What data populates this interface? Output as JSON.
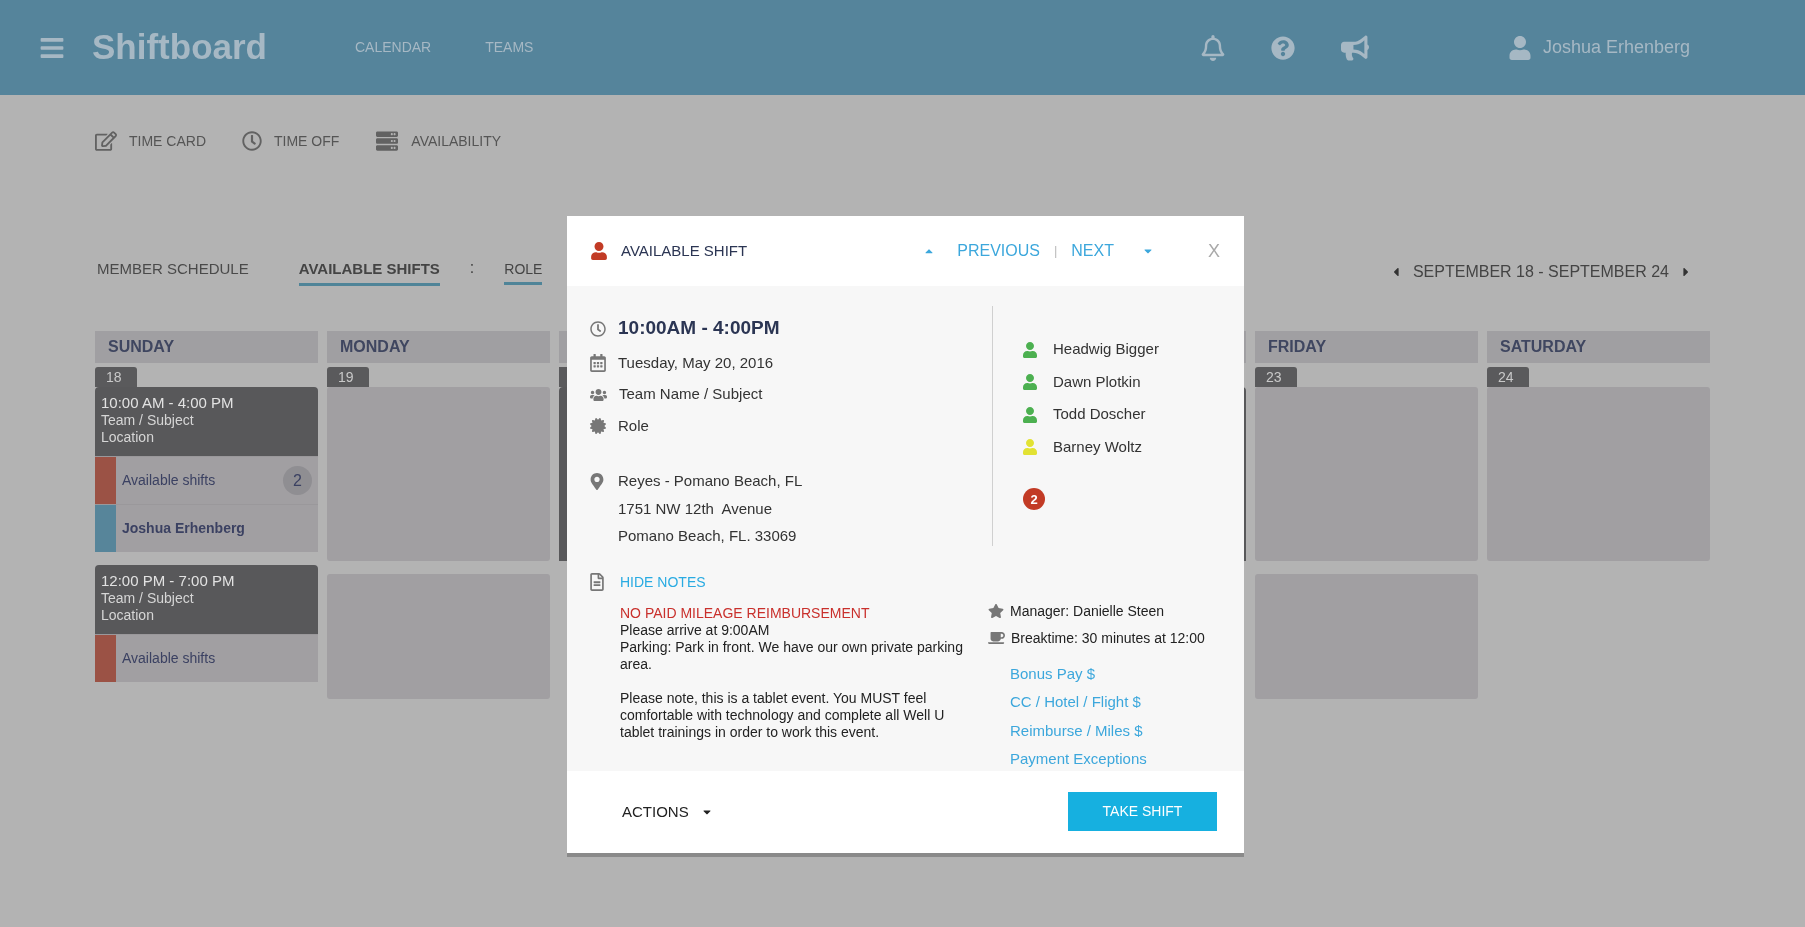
{
  "header": {
    "logo": "Shiftboard",
    "nav": [
      "CALENDAR",
      "TEAMS"
    ],
    "user": "Joshua Erhenberg"
  },
  "subnav": [
    {
      "kind": "timecard",
      "label": "TIME CARD"
    },
    {
      "kind": "timeoff",
      "label": "TIME OFF"
    },
    {
      "kind": "availability",
      "label": "AVAILABILITY"
    }
  ],
  "view_tabs": [
    {
      "label": "MEMBER SCHEDULE",
      "selected": false
    },
    {
      "label": "AVAILABLE SHIFTS",
      "selected": true
    }
  ],
  "separator": ":",
  "filter": {
    "label": "ROLE"
  },
  "date_range": "SEPTEMBER 18 - SEPTEMBER 24",
  "days": [
    {
      "name": "SUNDAY",
      "date": "18",
      "slots": [
        {
          "kind": "event",
          "time": "10:00 AM - 4:00 PM",
          "team": "Team / Subject",
          "location": "Location",
          "rows": [
            {
              "label": "Available shifts",
              "color": "#9b5245",
              "count": "2",
              "bold": false
            },
            {
              "label": "Joshua Erhenberg",
              "color": "#57859a",
              "bold": true
            }
          ]
        },
        {
          "kind": "event",
          "time": "12:00 PM - 7:00 PM",
          "team": "Team / Subject",
          "location": "Location",
          "rows": [
            {
              "label": "Available shifts",
              "color": "#9b5245",
              "bold": false
            }
          ]
        }
      ]
    },
    {
      "name": "MONDAY",
      "date": "19",
      "slots": [
        {
          "kind": "empty"
        },
        {
          "kind": "empty"
        }
      ]
    },
    {
      "name": "FRIDAY",
      "date": "23",
      "slots": [
        {
          "kind": "empty"
        },
        {
          "kind": "empty"
        }
      ]
    },
    {
      "name": "SATURDAY",
      "date": "24",
      "slots": [
        {
          "kind": "empty"
        }
      ]
    }
  ],
  "modal": {
    "title": "AVAILABLE SHIFT",
    "previous": "PREVIOUS",
    "divider": "|",
    "next": "NEXT",
    "close": "X",
    "time": "10:00AM - 4:00PM",
    "date": "Tuesday, May 20, 2016",
    "team": "Team Name / Subject",
    "role": "Role",
    "address": [
      "Reyes - Pomano Beach, FL",
      "1751 NW 12th  Avenue",
      "Pomano Beach, FL. 33069"
    ],
    "members": [
      {
        "name": "Headwig Bigger",
        "color": "#4cb050"
      },
      {
        "name": "Dawn Plotkin",
        "color": "#4cb050"
      },
      {
        "name": "Todd Doscher",
        "color": "#4cb050"
      },
      {
        "name": "Barney Woltz",
        "color": "#e2e233"
      }
    ],
    "member_badge": "2",
    "notes_toggle": "HIDE NOTES",
    "notes_alert": "NO PAID MILEAGE REIMBURSEMENT",
    "notes": [
      [
        "Please arrive at 9:00AM",
        "Parking: Park in front. We have our own private parking area."
      ],
      [
        "Please note, this is a tablet event. You MUST feel comfortable with technology and complete all Well U tablet trainings in order to work this event."
      ]
    ],
    "manager": "Manager: Danielle Steen",
    "breaktime": "Breaktime: 30 minutes at 12:00",
    "pay_links": [
      "Bonus Pay $",
      "CC / Hotel / Flight $",
      "Reimburse / Miles $",
      "Payment Exceptions"
    ],
    "actions": "ACTIONS",
    "take_shift": "TAKE SHIFT"
  }
}
